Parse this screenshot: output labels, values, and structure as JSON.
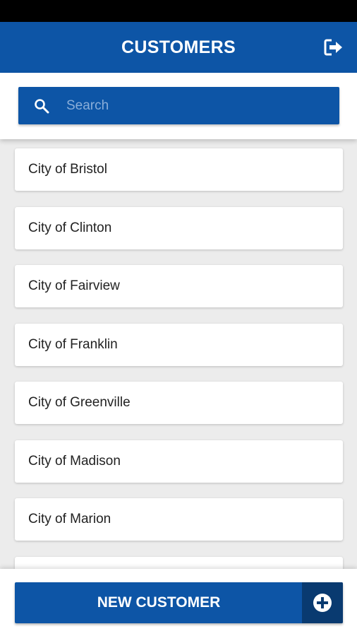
{
  "header": {
    "title": "CUSTOMERS",
    "logout_icon": "logout-icon"
  },
  "search": {
    "placeholder": "Search",
    "value": "",
    "icon": "search-icon"
  },
  "customers": [
    {
      "label": "City of Bristol"
    },
    {
      "label": "City of Clinton"
    },
    {
      "label": "City of Fairview"
    },
    {
      "label": "City of Franklin"
    },
    {
      "label": "City of Greenville"
    },
    {
      "label": "City of Madison"
    },
    {
      "label": "City of Marion"
    }
  ],
  "footer": {
    "new_customer_label": "NEW CUSTOMER",
    "add_icon": "plus-circle-icon"
  },
  "colors": {
    "primary": "#0d55a6",
    "primary_dark": "#093a70",
    "background": "#ececec"
  }
}
